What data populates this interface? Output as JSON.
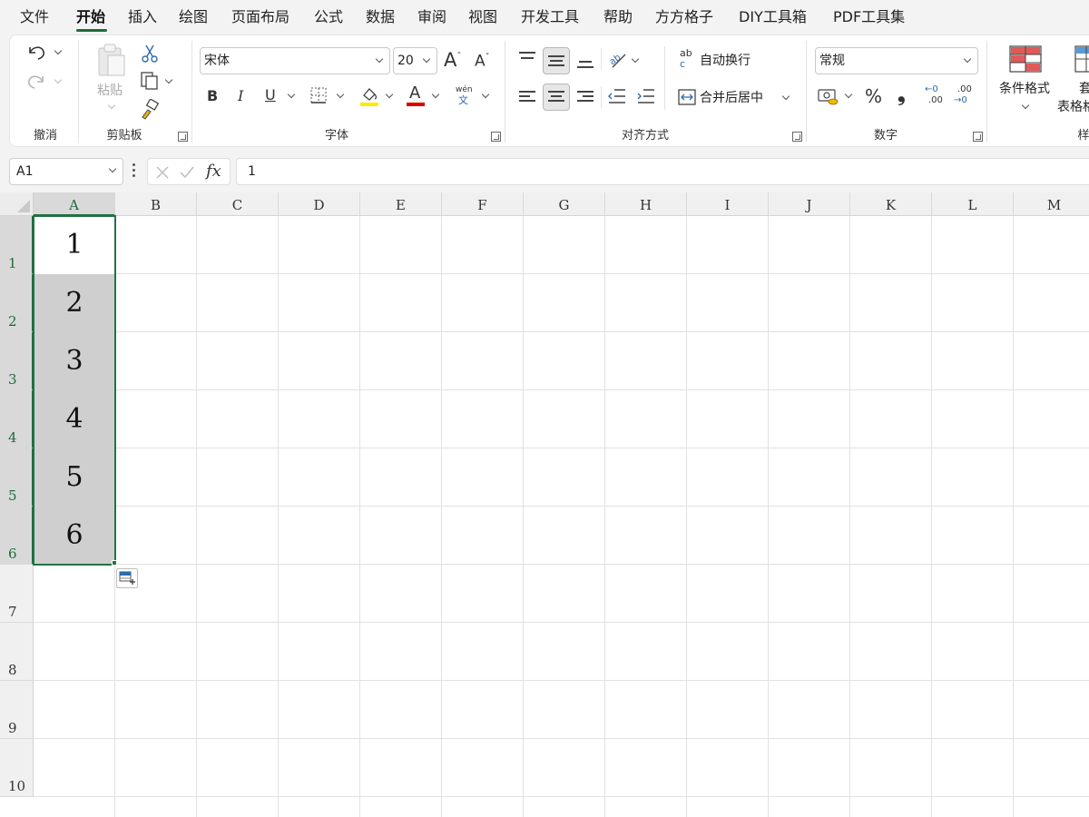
{
  "menu": {
    "tabs": [
      "文件",
      "开始",
      "插入",
      "绘图",
      "页面布局",
      "公式",
      "数据",
      "审阅",
      "视图",
      "开发工具",
      "帮助",
      "方方格子",
      "DIY工具箱",
      "PDF工具集"
    ],
    "active": "开始"
  },
  "ribbon": {
    "groups": {
      "undo": "撤消",
      "clipboard": "剪贴板",
      "font": "字体",
      "alignment": "对齐方式",
      "number": "数字",
      "styles_partial": "样"
    },
    "clipboard": {
      "paste_label": "粘贴"
    },
    "font": {
      "name": "宋体",
      "size": "20",
      "bold": "B",
      "italic": "I",
      "underline": "U",
      "increase": "A",
      "decrease": "A",
      "font_color_glyph": "A",
      "phonetic_top": "wén",
      "phonetic_bottom": "文"
    },
    "alignment": {
      "wrap_text": "自动换行",
      "merge_center": "合并后居中",
      "wrap_icon_top": "ab",
      "wrap_icon_bottom": "c"
    },
    "number": {
      "format": "常规",
      "percent": "%",
      "comma": "❟",
      "inc_decimal_top": "←0",
      "inc_decimal_bottom": ".00",
      "dec_decimal_top": ".00",
      "dec_decimal_bottom": "→0"
    },
    "styles": {
      "conditional_format": "条件格式",
      "table_format_line1": "套",
      "table_format_line2": "表格格"
    }
  },
  "formula_bar": {
    "name_box": "A1",
    "fx": "fx",
    "value": "1"
  },
  "grid": {
    "columns": [
      "A",
      "B",
      "C",
      "D",
      "E",
      "F",
      "G",
      "H",
      "I",
      "J",
      "K",
      "L",
      "M"
    ],
    "rows": [
      "1",
      "2",
      "3",
      "4",
      "5",
      "6",
      "7",
      "8",
      "9",
      "10"
    ],
    "cells": [
      "1",
      "2",
      "3",
      "4",
      "5",
      "6"
    ],
    "selection": "A1:A6",
    "active_cell": "A1"
  },
  "colors": {
    "accent": "#217346",
    "highlight_fill": "#cfcfcf",
    "font_highlight": "#ffea00",
    "font_color": "#e00000"
  }
}
